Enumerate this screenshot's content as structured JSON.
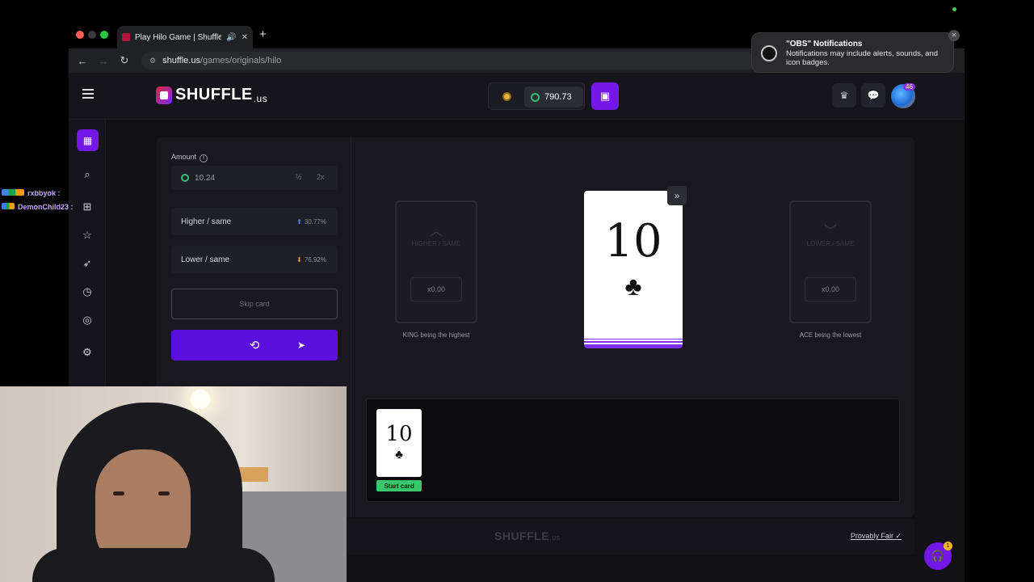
{
  "browser": {
    "tab_title": "Play Hilo Game | Shuffle.us",
    "url_host": "shuffle.us",
    "url_path": "/games/originals/hilo"
  },
  "header": {
    "logo_text": "SHUFFLE",
    "logo_tld": ".us",
    "balance": "790.73",
    "avatar_badge": "46"
  },
  "controls": {
    "amount_label": "Amount",
    "amount_value": "10.24",
    "half_label": "½",
    "double_label": "2x",
    "higher_label": "Higher / same",
    "higher_pct": "30.77%",
    "lower_label": "Lower / same",
    "lower_pct": "76.92%",
    "skip_label": "Skip card"
  },
  "board": {
    "higher_card_label": "HIGHER / SAME",
    "higher_mult": "x0.00",
    "higher_note": "KING being the highest",
    "lower_card_label": "LOWER / SAME",
    "lower_mult": "x0.00",
    "lower_note": "ACE being the lowest",
    "current_rank": "10",
    "current_suit": "♣"
  },
  "history": {
    "cards": [
      {
        "rank": "10",
        "suit": "♣",
        "label": "Start card"
      }
    ]
  },
  "footer": {
    "logo": "SHUFFLE",
    "logo_tld": ".us",
    "provably_fair": "Provably Fair"
  },
  "support_badge": "1",
  "notification": {
    "title": "\"OBS\" Notifications",
    "body": "Notifications may include alerts, sounds, and icon badges."
  },
  "chat": [
    {
      "user": "rxbbyok :"
    },
    {
      "user": "DemonChild23 :"
    }
  ],
  "colors": {
    "accent": "#7318e6",
    "bet_button": "#5c10e0",
    "start_label": "#38c76a"
  }
}
